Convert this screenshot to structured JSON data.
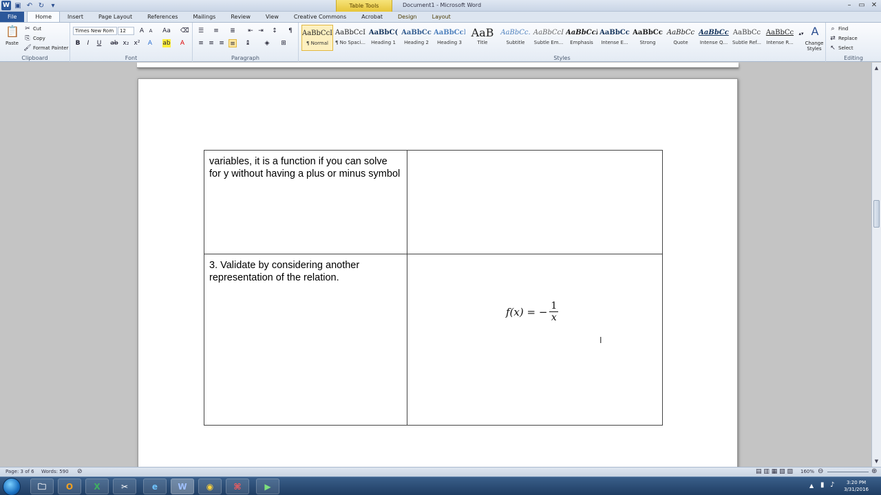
{
  "window": {
    "title": "Document1 - Microsoft Word",
    "context_tab_group": "Table Tools"
  },
  "tabs": [
    "File",
    "Home",
    "Insert",
    "Page Layout",
    "References",
    "Mailings",
    "Review",
    "View",
    "Creative Commons",
    "Acrobat",
    "Design",
    "Layout"
  ],
  "active_tab": "Home",
  "clipboard": {
    "group_label": "Clipboard",
    "paste": "Paste",
    "cut": "Cut",
    "copy": "Copy",
    "format_painter": "Format Painter"
  },
  "font": {
    "group_label": "Font",
    "name": "Times New Rom",
    "size": "12"
  },
  "paragraph": {
    "group_label": "Paragraph"
  },
  "styles": {
    "group_label": "Styles",
    "items": [
      {
        "preview": "AaBbCcI",
        "label": "¶ Normal"
      },
      {
        "preview": "AaBbCcI",
        "label": "¶ No Spaci..."
      },
      {
        "preview": "AaBbC(",
        "label": "Heading 1"
      },
      {
        "preview": "AaBbCc",
        "label": "Heading 2"
      },
      {
        "preview": "AaBbCcI",
        "label": "Heading 3"
      },
      {
        "preview": "AaB",
        "label": "Title"
      },
      {
        "preview": "AaBbCc.",
        "label": "Subtitle"
      },
      {
        "preview": "AaBbCcI",
        "label": "Subtle Em..."
      },
      {
        "preview": "AaBbCcI",
        "label": "Emphasis"
      },
      {
        "preview": "AaBbCc",
        "label": "Intense E..."
      },
      {
        "preview": "AaBbCc",
        "label": "Strong"
      },
      {
        "preview": "AaBbCc",
        "label": "Quote"
      },
      {
        "preview": "AaBbCc",
        "label": "Intense Q..."
      },
      {
        "preview": "AaBbCc",
        "label": "Subtle Ref..."
      },
      {
        "preview": "AaBbCc",
        "label": "Intense R..."
      }
    ],
    "change_styles": "Change Styles"
  },
  "editing": {
    "group_label": "Editing",
    "find": "Find",
    "replace": "Replace",
    "select": "Select"
  },
  "document": {
    "row1_left": "variables, it is a function if you can solve for y without having a plus or minus symbol",
    "row1_right": "",
    "row2_left": "3. Validate by considering another representation of the relation.",
    "row2_right": "",
    "math": {
      "lhs": "f(x) = −",
      "numerator": "1",
      "denominator": "x"
    }
  },
  "status": {
    "page": "Page: 3 of 6",
    "words": "Words: 590",
    "zoom": "160%"
  },
  "clock": {
    "time": "3:20 PM",
    "date": "3/31/2016"
  }
}
